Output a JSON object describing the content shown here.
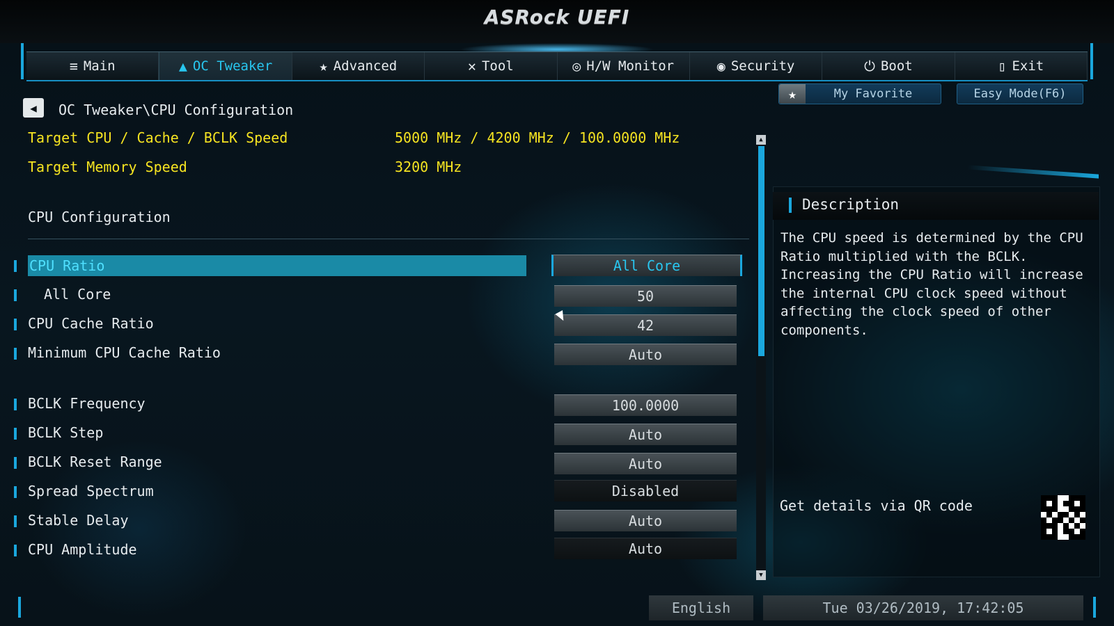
{
  "header": {
    "logo": "ASRock UEFI"
  },
  "tabs": [
    {
      "label": "Main",
      "icon": "≡",
      "active": false
    },
    {
      "label": "OC Tweaker",
      "icon": "▲",
      "active": true
    },
    {
      "label": "Advanced",
      "icon": "★",
      "active": false
    },
    {
      "label": "Tool",
      "icon": "✕",
      "active": false
    },
    {
      "label": "H/W Monitor",
      "icon": "◎",
      "active": false
    },
    {
      "label": "Security",
      "icon": "◉",
      "active": false
    },
    {
      "label": "Boot",
      "icon": "⏻",
      "active": false
    },
    {
      "label": "Exit",
      "icon": "▯",
      "active": false
    }
  ],
  "toolbar": {
    "favorite_label": "My Favorite",
    "easy_mode_label": "Easy Mode(F6)"
  },
  "breadcrumb": "OC Tweaker\\CPU Configuration",
  "info": [
    {
      "label": "Target CPU / Cache / BCLK Speed",
      "value": "5000 MHz / 4200 MHz / 100.0000 MHz"
    },
    {
      "label": "Target Memory Speed",
      "value": "3200 MHz"
    }
  ],
  "section_title": "CPU Configuration",
  "settings": [
    {
      "label": "CPU Ratio",
      "value": "All Core"
    },
    {
      "label": "All Core",
      "value": "50"
    },
    {
      "label": "CPU Cache Ratio",
      "value": "42"
    },
    {
      "label": "Minimum CPU Cache Ratio",
      "value": "Auto"
    },
    {
      "label": "BCLK Frequency",
      "value": "100.0000"
    },
    {
      "label": "BCLK Step",
      "value": "Auto"
    },
    {
      "label": "BCLK Reset Range",
      "value": "Auto"
    },
    {
      "label": "Spread Spectrum",
      "value": "Disabled"
    },
    {
      "label": "Stable Delay",
      "value": "Auto"
    },
    {
      "label": "CPU Amplitude",
      "value": "Auto"
    }
  ],
  "description": {
    "title": "Description",
    "text": "The CPU speed is determined by the CPU\nRatio multiplied with the BCLK.\nIncreasing the CPU Ratio will increase\nthe internal CPU clock speed without\naffecting the clock speed of other\ncomponents.",
    "qr_label": "Get details via QR code"
  },
  "footer": {
    "language": "English",
    "datetime": "Tue 03/26/2019, 17:42:05"
  },
  "colors": {
    "accent": "#1aa7dd",
    "highlight": "#f6e421",
    "selected_bg": "#1a8aa6"
  }
}
